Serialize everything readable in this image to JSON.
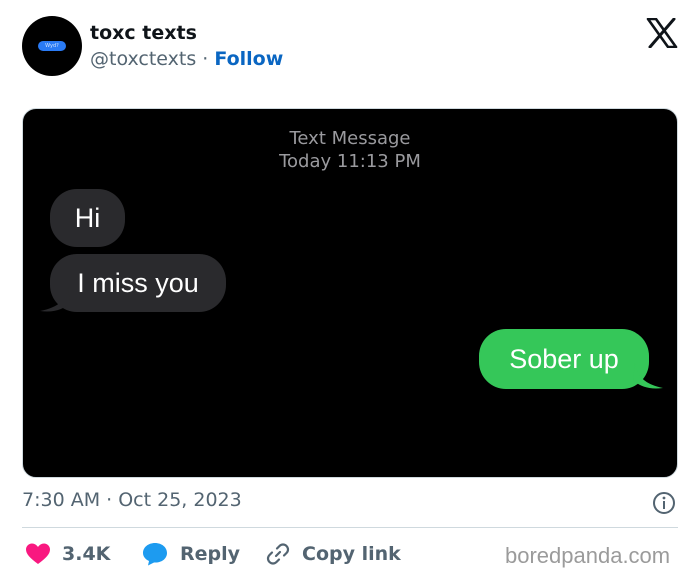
{
  "tweet": {
    "author_name": "toxc texts",
    "author_handle": "@toxctexts",
    "separator": "·",
    "follow_label": "Follow",
    "avatar_text": "Wyd?",
    "timestamp": "7:30 AM · Oct 25, 2023"
  },
  "conversation": {
    "header_line1": "Text Message",
    "header_line2": "Today 11:13 PM",
    "messages": [
      {
        "direction": "incoming",
        "text": "Hi"
      },
      {
        "direction": "incoming",
        "text": "I miss you"
      },
      {
        "direction": "outgoing",
        "text": "Sober up"
      }
    ]
  },
  "actions": {
    "likes_count": "3.4K",
    "reply_label": "Reply",
    "copy_link_label": "Copy link"
  },
  "watermark": "boredpanda.com",
  "colors": {
    "follow_blue": "#0a66c2",
    "heart_red": "#f91880",
    "reply_blue": "#1d9bf0",
    "incoming_bubble": "#2a2a2d",
    "outgoing_bubble": "#35c759"
  }
}
